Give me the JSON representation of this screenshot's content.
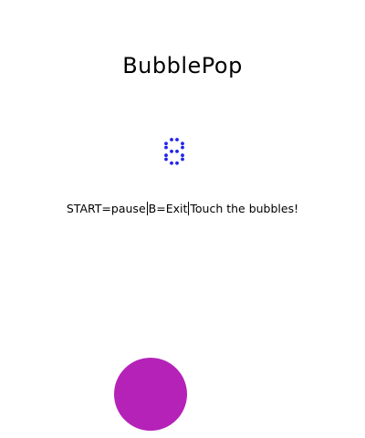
{
  "game": {
    "title": "BubblePop",
    "score": "8",
    "instructions": [
      "START=pause",
      "B=Exit",
      "Touch the bubbles!"
    ]
  },
  "colors": {
    "background": "#ffffff",
    "text": "#000000",
    "score_digit": "#2222ee",
    "bubble": "#b522b8"
  }
}
